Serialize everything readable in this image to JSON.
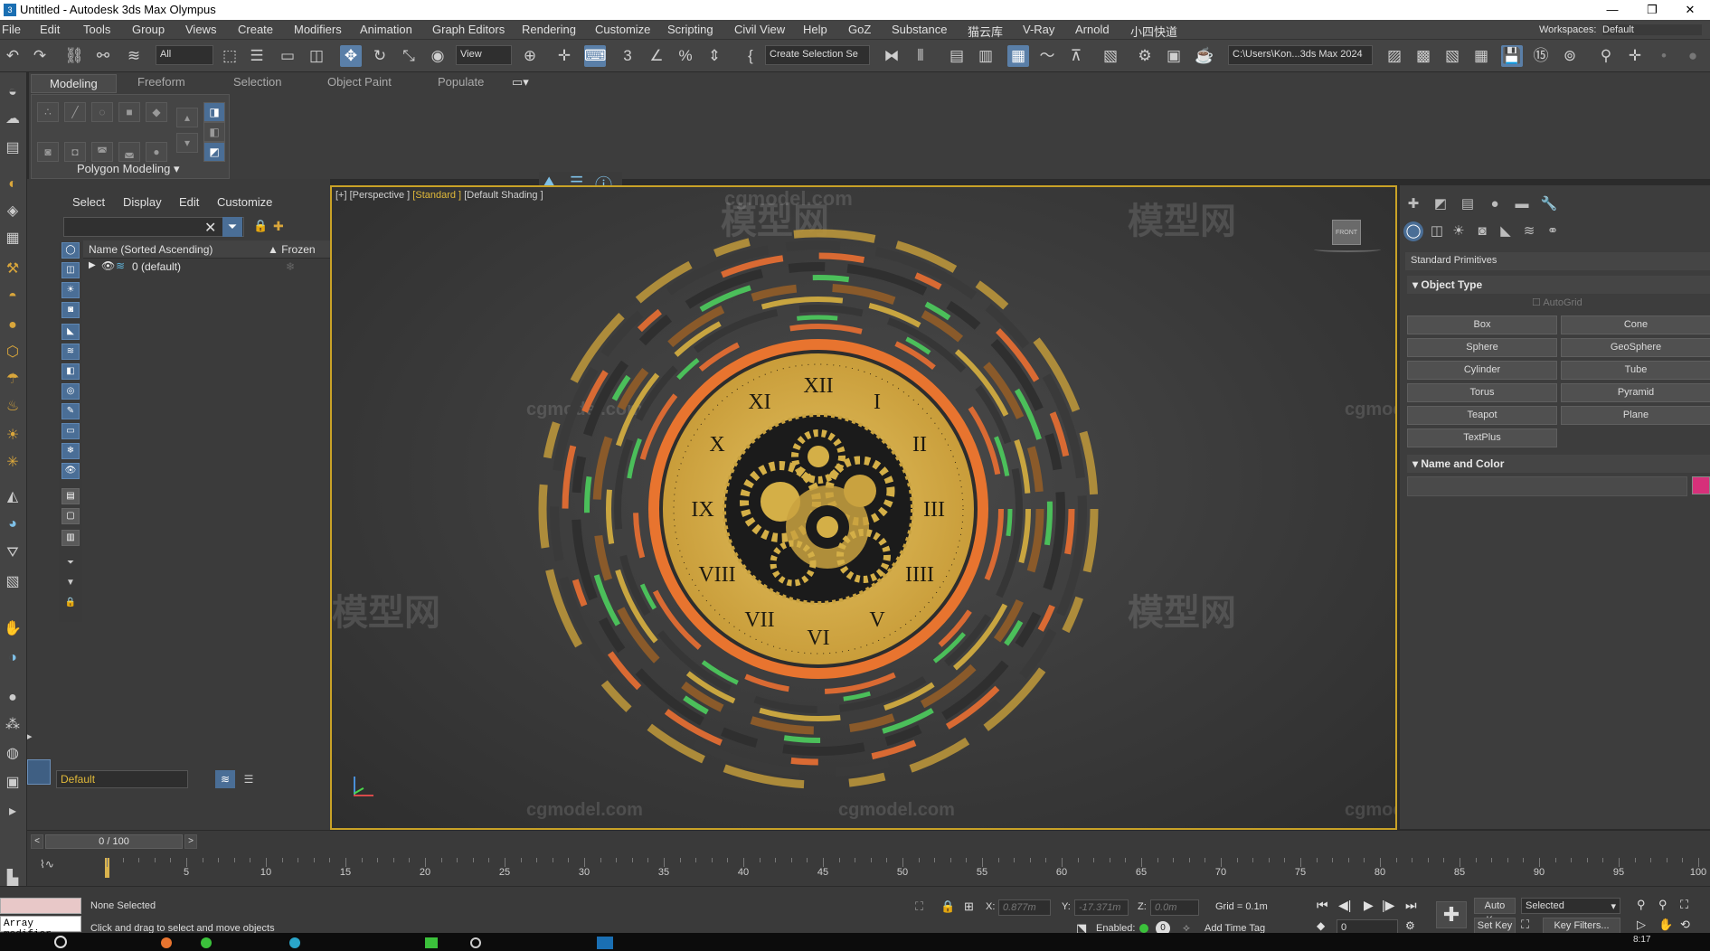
{
  "window": {
    "title": "Untitled - Autodesk 3ds Max Olympus",
    "controls": [
      "—",
      "❐",
      "✕"
    ]
  },
  "menu": [
    "File",
    "Edit",
    "Tools",
    "Group",
    "Views",
    "Create",
    "Modifiers",
    "Animation",
    "Graph Editors",
    "Rendering",
    "Customize",
    "Scripting",
    "Civil View",
    "Help",
    "GoZ",
    "Substance",
    "猫云库",
    "V-Ray",
    "Arnold",
    "小四快道"
  ],
  "workspaces": {
    "label": "Workspaces:",
    "value": "Default"
  },
  "toolbar": {
    "filter_value": "All",
    "view_value": "View",
    "selection_set_placeholder": "Create Selection Se",
    "path_value": "C:\\Users\\Kon...3ds Max 2024"
  },
  "ribbon": {
    "tabs": [
      "Modeling",
      "Freeform",
      "Selection",
      "Object Paint",
      "Populate"
    ],
    "panel_label": "Polygon Modeling"
  },
  "scene_explorer": {
    "menu": [
      "Select",
      "Display",
      "Edit",
      "Customize"
    ],
    "column_name": "Name (Sorted Ascending)",
    "column_frozen": "▲ Frozen",
    "layer_name": "0 (default)",
    "layer_footer": "Default"
  },
  "viewport": {
    "label_prefix": "[+] [Perspective ]",
    "label_mode": "[Standard ]",
    "label_shading": "[Default Shading ]",
    "viewcube_label": "FRONT",
    "watermarks": [
      "cgmodel.com",
      "模型网"
    ],
    "clock_numerals": [
      "XII",
      "I",
      "II",
      "III",
      "IIII",
      "V",
      "VI",
      "VII",
      "VIII",
      "IX",
      "X",
      "XI"
    ]
  },
  "command_panel": {
    "category": "Standard Primitives",
    "object_type_title": "Object Type",
    "autogrid": "AutoGrid",
    "primitives": [
      "Box",
      "Cone",
      "Sphere",
      "GeoSphere",
      "Cylinder",
      "Tube",
      "Torus",
      "Pyramid",
      "Teapot",
      "Plane",
      "TextPlus"
    ],
    "name_color_title": "Name and Color",
    "object_color": "#d6307a"
  },
  "timeline": {
    "frame_counter": "0 / 100",
    "ticks": [
      5,
      10,
      15,
      20,
      25,
      30,
      35,
      40,
      45,
      50,
      55,
      60,
      65,
      70,
      75,
      80,
      85,
      90,
      95,
      100
    ]
  },
  "status": {
    "maxscript_text": "Array modifier",
    "selection_text": "None Selected",
    "prompt_text": "Click and drag to select and move objects",
    "x_label": "X:",
    "x_value": "0.877m",
    "y_label": "Y:",
    "y_value": "-17.371m",
    "z_label": "Z:",
    "z_value": "0.0m",
    "grid": "Grid = 0.1m",
    "enabled_label": "Enabled:",
    "add_time_tag": "Add Time Tag",
    "auto_key": "Auto Key",
    "set_key": "Set Key",
    "key_mode": "Selected",
    "key_filters": "Key Filters...",
    "frame_value": "0",
    "clock": "8:17"
  },
  "colors": {
    "accent_yellow": "#c9a227",
    "active_blue": "#4a6e96",
    "clock_orange": "#e86a2c",
    "clock_gold": "#d9b34e"
  }
}
